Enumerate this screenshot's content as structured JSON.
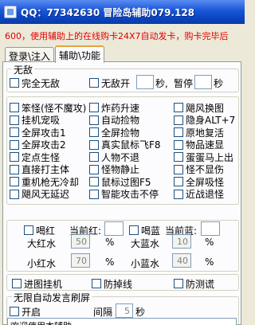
{
  "window": {
    "title": "QQ：77342630 冒险岛辅助079.128"
  },
  "notice": "600，使用辅助上的在线购卡24X7自动发卡，购卡完毕后",
  "tabs": [
    {
      "label": "登录\\注入",
      "active": false
    },
    {
      "label": "辅助\\功能",
      "active": true
    }
  ],
  "invincible": {
    "legend": "无敌",
    "full_label": "完全无敌",
    "timed_label": "无敌开",
    "seconds_label": "秒,",
    "pause_label": "暂停",
    "pause_unit": "秒"
  },
  "features": [
    [
      "笨怪(怪不魔攻)",
      "炸药升速",
      "飓风换图"
    ],
    [
      "挂机宠吸",
      "自动捡物",
      "隐身ALT+7"
    ],
    [
      "全屏攻击1",
      "全屏捡物",
      "原地复活"
    ],
    [
      "全屏攻击2",
      "真实鼠标飞F8",
      "物品速显"
    ],
    [
      "定点生怪",
      "人物不退",
      "蛋蛋马上出"
    ],
    [
      "直接打主体",
      "怪物静止",
      "怪不显伤"
    ],
    [
      "重机枪无冷却",
      "鼠标过图F5",
      "全屏吸怪"
    ],
    [
      "飓风无延迟",
      "智能攻击不停",
      "近战退怪"
    ]
  ],
  "potions": {
    "hp_label": "喝红",
    "hp_current_label": "当前红:",
    "mp_label": "喝蓝",
    "mp_current_label": "当前蓝:",
    "big_red_label": "大红水",
    "big_red_value": "50",
    "big_blue_label": "大蓝水",
    "big_blue_value": "10",
    "small_red_label": "小红水",
    "small_red_value": "70",
    "small_blue_label": "小蓝水",
    "small_blue_value": "40",
    "percent": "%"
  },
  "misc": {
    "map_hang": "进图挂机",
    "anti_drop": "防掉线",
    "anti_test": "防测谎"
  },
  "spam": {
    "legend": "无限自动发言刷屏",
    "enable_label": "开启",
    "interval_label": "间隔",
    "interval_value": "5",
    "interval_unit": "秒",
    "message": "欢迎使用本辅助"
  }
}
